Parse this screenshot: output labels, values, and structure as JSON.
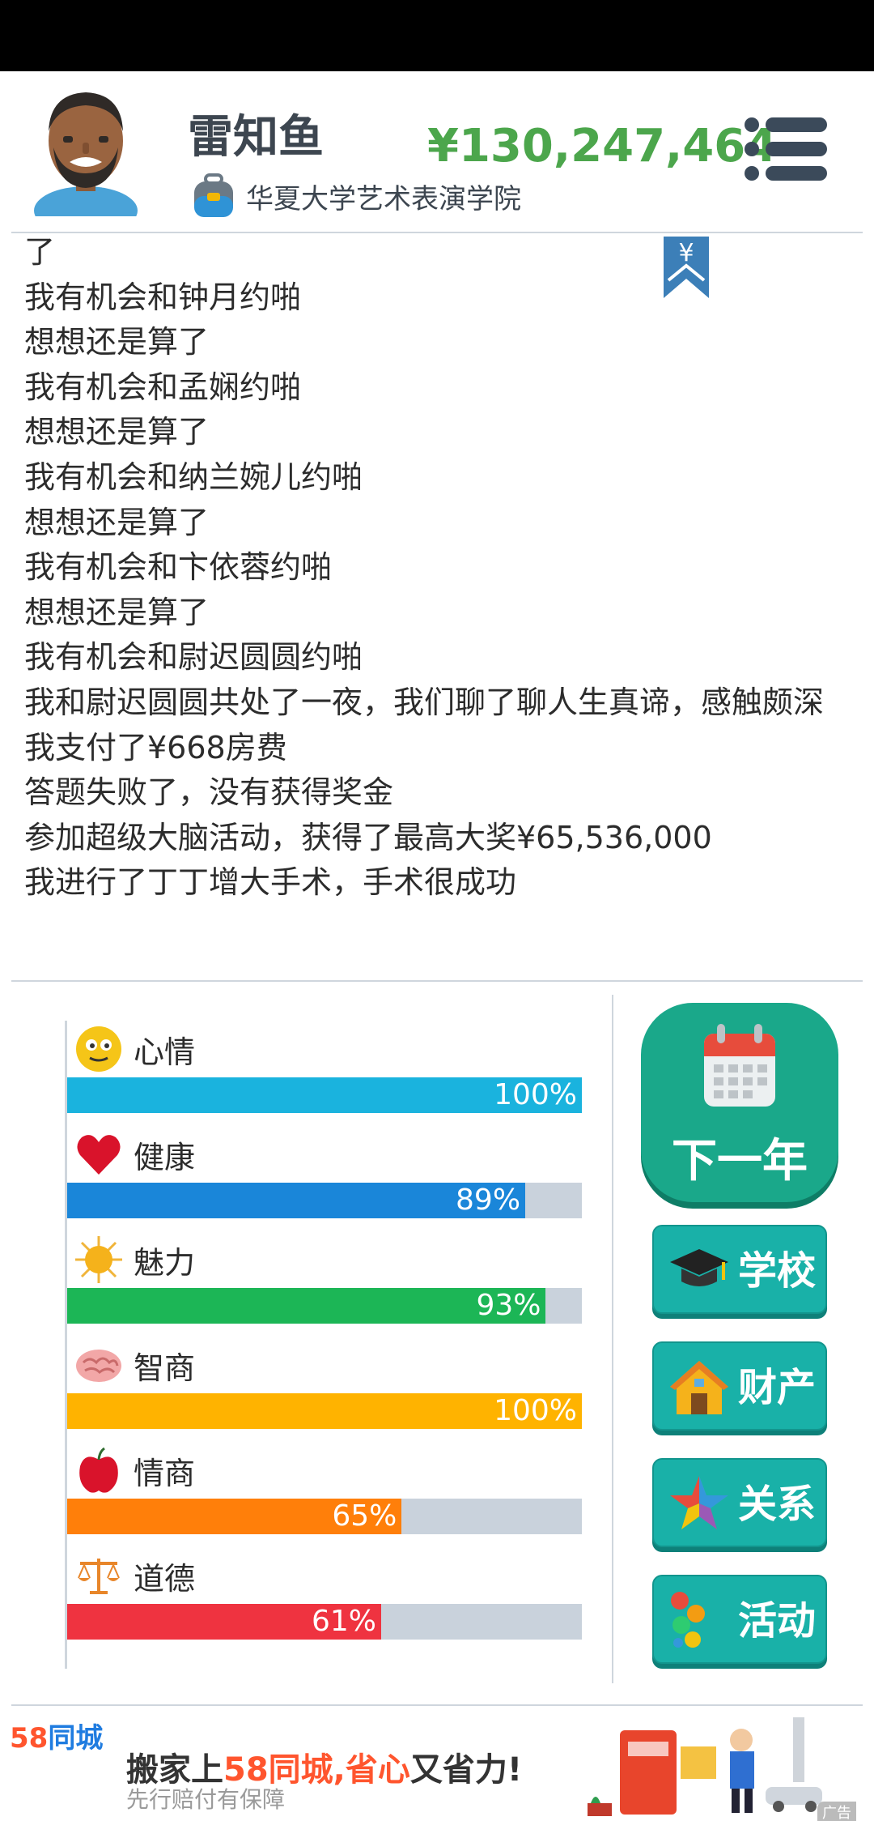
{
  "player": {
    "name": "雷知鱼",
    "school": "华夏大学艺术表演学院",
    "money": "¥130,247,464"
  },
  "log": [
    "了",
    "我有机会和钟月约啪",
    "想想还是算了",
    "我有机会和孟娴约啪",
    "想想还是算了",
    "我有机会和纳兰婉儿约啪",
    "想想还是算了",
    "我有机会和卞依蓉约啪",
    "想想还是算了",
    "我有机会和尉迟圆圆约啪",
    "我和尉迟圆圆共处了一夜，我们聊了聊人生真谛，感触颇深",
    "我支付了¥668房费",
    "答题失败了，没有获得奖金",
    "参加超级大脑活动，获得了最高大奖¥65,536,000",
    "我进行了丁丁增大手术，手术很成功"
  ],
  "bookmark_symbol": "¥",
  "stats": [
    {
      "label": "心情",
      "icon": "smiley-icon",
      "value": 100,
      "display": "100%",
      "color": "#1ab3de"
    },
    {
      "label": "健康",
      "icon": "heart-icon",
      "value": 89,
      "display": "89%",
      "color": "#1a86d9"
    },
    {
      "label": "魅力",
      "icon": "sun-icon",
      "value": 93,
      "display": "93%",
      "color": "#1cb656"
    },
    {
      "label": "智商",
      "icon": "brain-icon",
      "value": 100,
      "display": "100%",
      "color": "#ffb300"
    },
    {
      "label": "情商",
      "icon": "apple-icon",
      "value": 65,
      "display": "65%",
      "color": "#ff7f0a"
    },
    {
      "label": "道德",
      "icon": "scales-icon",
      "value": 61,
      "display": "61%",
      "color": "#ef3340"
    }
  ],
  "actions": {
    "next_year": "下一年",
    "school": "学校",
    "property": "财产",
    "relations": "关系",
    "activities": "活动"
  },
  "ad": {
    "logo_num": "58",
    "logo_text": "同城",
    "slogan_a": "搬家上",
    "slogan_b": "58同城,省心",
    "slogan_c": "又省力!",
    "sub": "先行赔付有保障",
    "tag": "广告"
  }
}
